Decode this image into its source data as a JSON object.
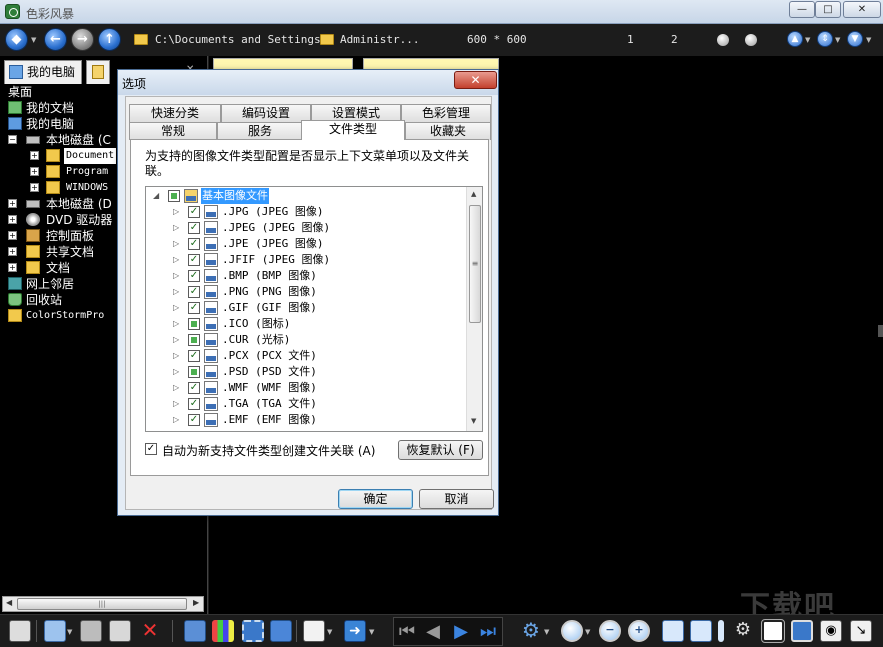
{
  "window": {
    "title": "色彩风暴",
    "min_label": "—",
    "max_label": "□",
    "close_label": "✕"
  },
  "toolbar": {
    "path1": "C:\\Documents and Settings",
    "path2": "Administr...",
    "dimensions": "600 * 600",
    "page_current": "1",
    "page_total": "2"
  },
  "left_panel": {
    "tab_computer": "我的电脑",
    "tree": [
      {
        "label": "桌面"
      },
      {
        "label": "我的文档"
      },
      {
        "label": "我的电脑"
      },
      {
        "label": "本地磁盘 (C"
      },
      {
        "label": "Document"
      },
      {
        "label": "Program "
      },
      {
        "label": "WINDOWS"
      },
      {
        "label": "本地磁盘 (D"
      },
      {
        "label": "DVD 驱动器"
      },
      {
        "label": "控制面板"
      },
      {
        "label": "共享文档"
      },
      {
        "label": "文档"
      },
      {
        "label": "网上邻居"
      },
      {
        "label": "回收站"
      },
      {
        "label": "ColorStormPro"
      }
    ]
  },
  "dialog": {
    "title": "选项",
    "tabs_row1": [
      "快速分类",
      "编码设置",
      "设置模式",
      "色彩管理"
    ],
    "tabs_row2": [
      "常规",
      "服务",
      "文件类型",
      "收藏夹"
    ],
    "active_tab": "文件类型",
    "description": "为支持的图像文件类型配置是否显示上下文菜单项以及文件关联。",
    "root_label": "基本图像文件",
    "file_types": [
      {
        "label": ".JPG (JPEG 图像)",
        "checked": true
      },
      {
        "label": ".JPEG (JPEG 图像)",
        "checked": true
      },
      {
        "label": ".JPE (JPEG 图像)",
        "checked": true
      },
      {
        "label": ".JFIF (JPEG 图像)",
        "checked": true
      },
      {
        "label": ".BMP (BMP 图像)",
        "checked": true
      },
      {
        "label": ".PNG (PNG 图像)",
        "checked": true
      },
      {
        "label": ".GIF (GIF 图像)",
        "checked": true
      },
      {
        "label": ".ICO (图标)",
        "checked": false
      },
      {
        "label": ".CUR (光标)",
        "checked": false
      },
      {
        "label": ".PCX (PCX 文件)",
        "checked": true
      },
      {
        "label": ".PSD (PSD 文件)",
        "checked": false
      },
      {
        "label": ".WMF (WMF 图像)",
        "checked": true
      },
      {
        "label": ".TGA (TGA 文件)",
        "checked": true
      },
      {
        "label": ".EMF (EMF 图像)",
        "checked": true
      }
    ],
    "auto_assoc_label": "自动为新支持文件类型创建文件关联 (A)",
    "auto_assoc_checked": true,
    "restore_label": "恢复默认 (F)",
    "ok_label": "确定",
    "cancel_label": "取消"
  },
  "watermark": "下载吧"
}
